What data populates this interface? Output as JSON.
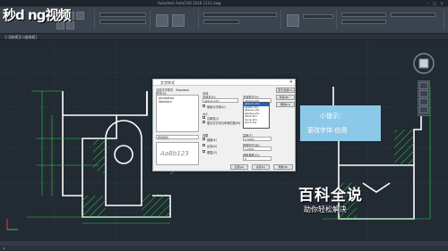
{
  "window": {
    "title": "Autodesk AutoCAD 2016   1111.dwg"
  },
  "logo": {
    "text": "秒d ng视频"
  },
  "document_tab": {
    "label": "[-][俯视][二维线框]"
  },
  "dialog": {
    "title": "文字样式",
    "current_style_label": "当前文字样式：Standard",
    "styles_label": "样式(S)：",
    "style_items": [
      "Annotative",
      "Standard"
    ],
    "filter_value": "所有样式",
    "preview_text": "AaBb123",
    "font_group": "字体",
    "font_name_label": "字体名(F)：",
    "font_name_value": "gbenor.shx",
    "font_style_label": "字体样式(Y)：",
    "font_style_value": "gbcbig.shx",
    "big_font_label": "使用大字体(U)",
    "size_group": "大小",
    "annotative_label": "注释性(I)",
    "match_label": "使文字方向与布局匹配(M)",
    "height_label": "高度(T)",
    "height_value": "0.0000",
    "effects_group": "效果",
    "upside_down_label": "颠倒(E)",
    "backwards_label": "反向(K)",
    "vertical_label": "垂直(V)",
    "width_factor_label": "宽度因子(W)：",
    "width_factor_value": "1.0000",
    "oblique_label": "倾斜角度(O)：",
    "oblique_value": "0",
    "buttons": {
      "set_current": "置为当前(C)",
      "new": "新建(N)...",
      "delete": "删除(D)",
      "apply": "应用(A)",
      "close": "关闭(C)",
      "help": "帮助(H)"
    },
    "dropdown_items": [
      "gbenor.shx",
      "gbeitc.shx",
      "gbenor.shx",
      "gbcbig.shx",
      "hztxt.shx",
      "isocp.shx",
      "isoct.shx"
    ]
  },
  "tip": {
    "line1": "小提示：",
    "line2": "更改字体-应用"
  },
  "watermark": {
    "big": "百科全说",
    "small": "助你轻松解决"
  },
  "colors": {
    "background": "#222a33",
    "lines": "#ffffff",
    "hatch": "#2ad14a",
    "tip": "#8cc8e8"
  }
}
